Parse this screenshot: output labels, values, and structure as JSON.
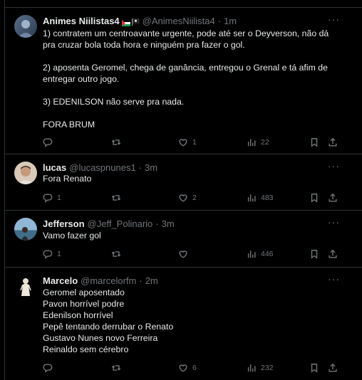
{
  "tweets": [
    {
      "name": "Animes Niilistas4",
      "handle": "@AnimesNiilista4",
      "time": "1m",
      "text": "1) contratem um centroavante urgente, pode até ser o Deyverson, não dá pra cruzar bola toda hora e ninguém pra fazer o gol.\n\n2) aposenta Geromel, chega de ganância, entregou o Grenal e tá afim de entregar outro jogo.\n\n3) EDENILSON não serve pra nada.\n\nFORA BRUM",
      "replies": "",
      "retweets": "",
      "likes": "1",
      "views": "22"
    },
    {
      "name": "lucas",
      "handle": "@lucaspnunes1",
      "time": "3m",
      "text": "Fora Renato",
      "replies": "1",
      "retweets": "",
      "likes": "2",
      "views": "483"
    },
    {
      "name": "Jefferson",
      "handle": "@Jeff_Polinario",
      "time": "3m",
      "text": "Vamo fazer gol",
      "replies": "1",
      "retweets": "",
      "likes": "",
      "views": "446"
    },
    {
      "name": "Marcelo",
      "handle": "@marcelorfm",
      "time": "2m",
      "text": "Geromel aposentado\nPavon horrível podre\nEdenilson horrível\nPepê tentando derrubar o Renato\nGustavo Nunes novo Ferreira\nReinaldo sem cérebro",
      "replies": "",
      "retweets": "",
      "likes": "6",
      "views": "232"
    }
  ],
  "icons": {
    "reply": "reply-icon",
    "retweet": "retweet-icon",
    "like": "like-icon",
    "views": "views-icon",
    "bookmark": "bookmark-icon",
    "share": "share-icon",
    "more": "more-icon"
  },
  "colors": {
    "background": "#000000",
    "text": "#e7e9ea",
    "muted": "#71767b",
    "border": "#2f3336"
  },
  "separator": "·"
}
